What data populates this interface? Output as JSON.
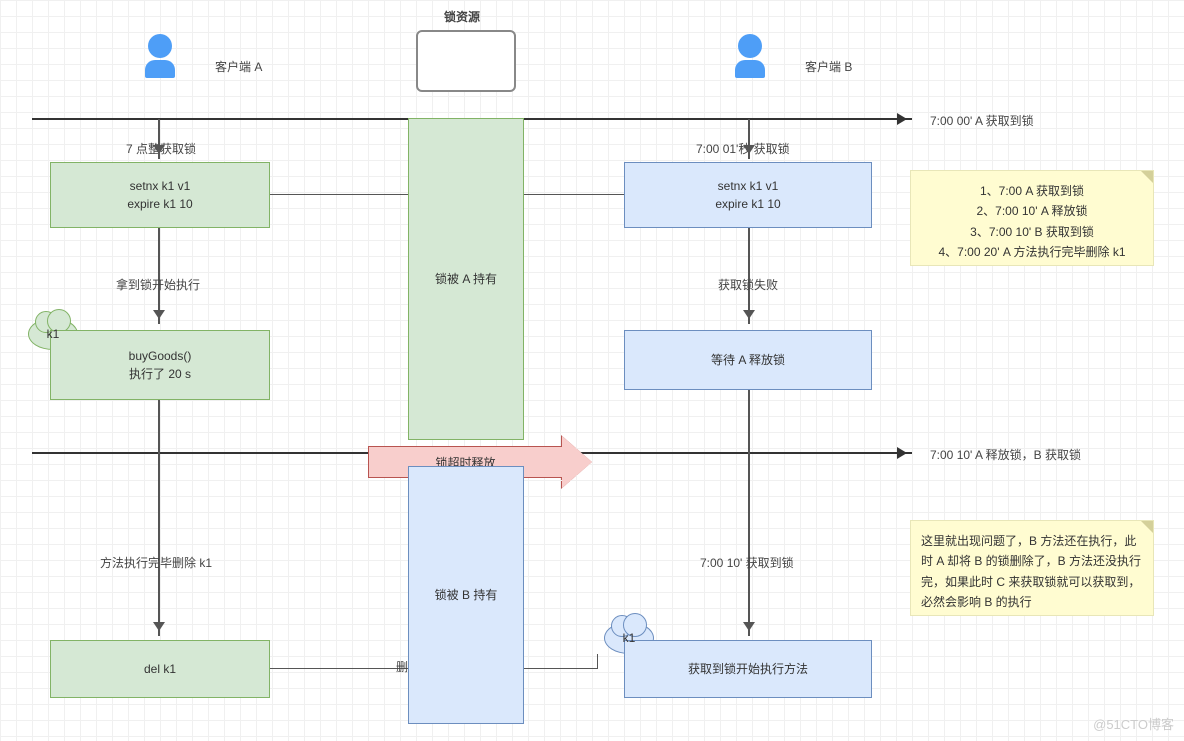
{
  "header": {
    "lock_resource": "锁资源",
    "client_a": "客户端 A",
    "client_b": "客户端 B"
  },
  "timeline": {
    "t1_label": "7:00 00' A 获取到锁",
    "t2_label": "7:00 10' A 释放锁，B 获取锁"
  },
  "clientA": {
    "get_lock": "7 点整获取锁",
    "setnx_l1": "setnx k1 v1",
    "setnx_l2": "expire k1 10",
    "start_exec": "拿到锁开始执行",
    "buygoods_l1": "buyGoods()",
    "buygoods_l2": "执行了 20 s",
    "cloud": "k1",
    "finish_del": "方法执行完毕删除 k1",
    "del": "del k1"
  },
  "clientB": {
    "get_lock": "7:00 01'秒 获取锁",
    "setnx_l1": "setnx k1 v1",
    "setnx_l2": "expire k1 10",
    "fail": "获取锁失败",
    "wait": "等待 A 释放锁",
    "got_lock": "7:00 10' 获取到锁",
    "cloud": "k1",
    "start_exec": "获取到锁开始执行方法"
  },
  "middle": {
    "held_a": "锁被 A 持有",
    "timeout": "锁超时释放",
    "held_b": "锁被 B 持有",
    "del_char": "删"
  },
  "notes": {
    "n1_l1": "1、7:00 A 获取到锁",
    "n1_l2": "2、7:00 10' A 释放锁",
    "n1_l3": "3、7:00 10' B 获取到锁",
    "n1_l4": "4、7:00 20' A 方法执行完毕删除 k1",
    "n2": "这里就出现问题了，B 方法还在执行，此时 A 却将 B 的锁删除了，B 方法还没执行完，如果此时 C 来获取锁就可以获取到，必然会影响 B 的执行"
  },
  "watermark": "@51CTO博客"
}
